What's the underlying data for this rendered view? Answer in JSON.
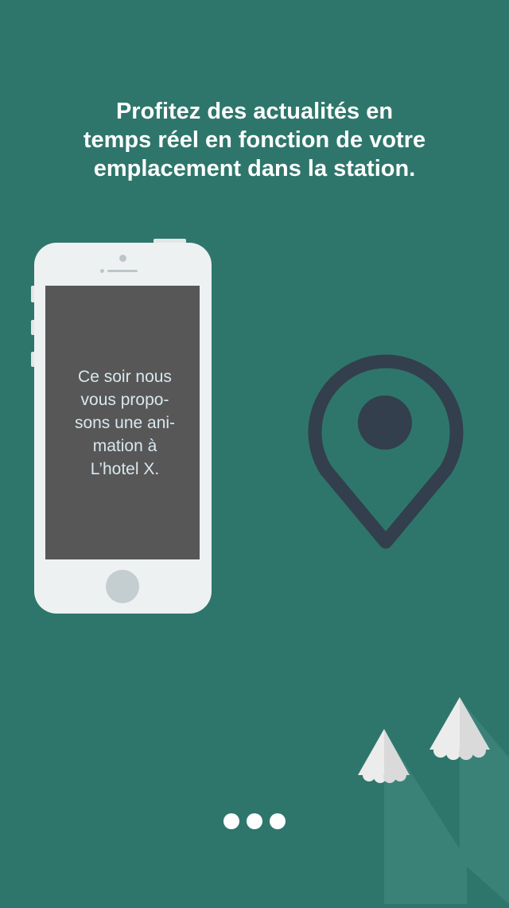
{
  "onboarding": {
    "headline_lines": [
      "Profitez des actualités en",
      "temps réel en fonction de votre",
      "emplacement dans la station."
    ]
  },
  "phone": {
    "screen_text_lines": [
      "Ce soir nous",
      "vous propo-",
      "sons une ani-",
      "mation à",
      "L’hotel X."
    ]
  },
  "pager": {
    "page_count": 3
  },
  "icons": {
    "location": "map-pin-icon",
    "decoration": "snowy-mountains"
  },
  "colors": {
    "background": "#2e766b",
    "pin": "#333f4d",
    "screen": "#575757",
    "screen_text": "#d9e8ee",
    "headline": "#ffffff",
    "phone_body": "#eef1f2"
  }
}
